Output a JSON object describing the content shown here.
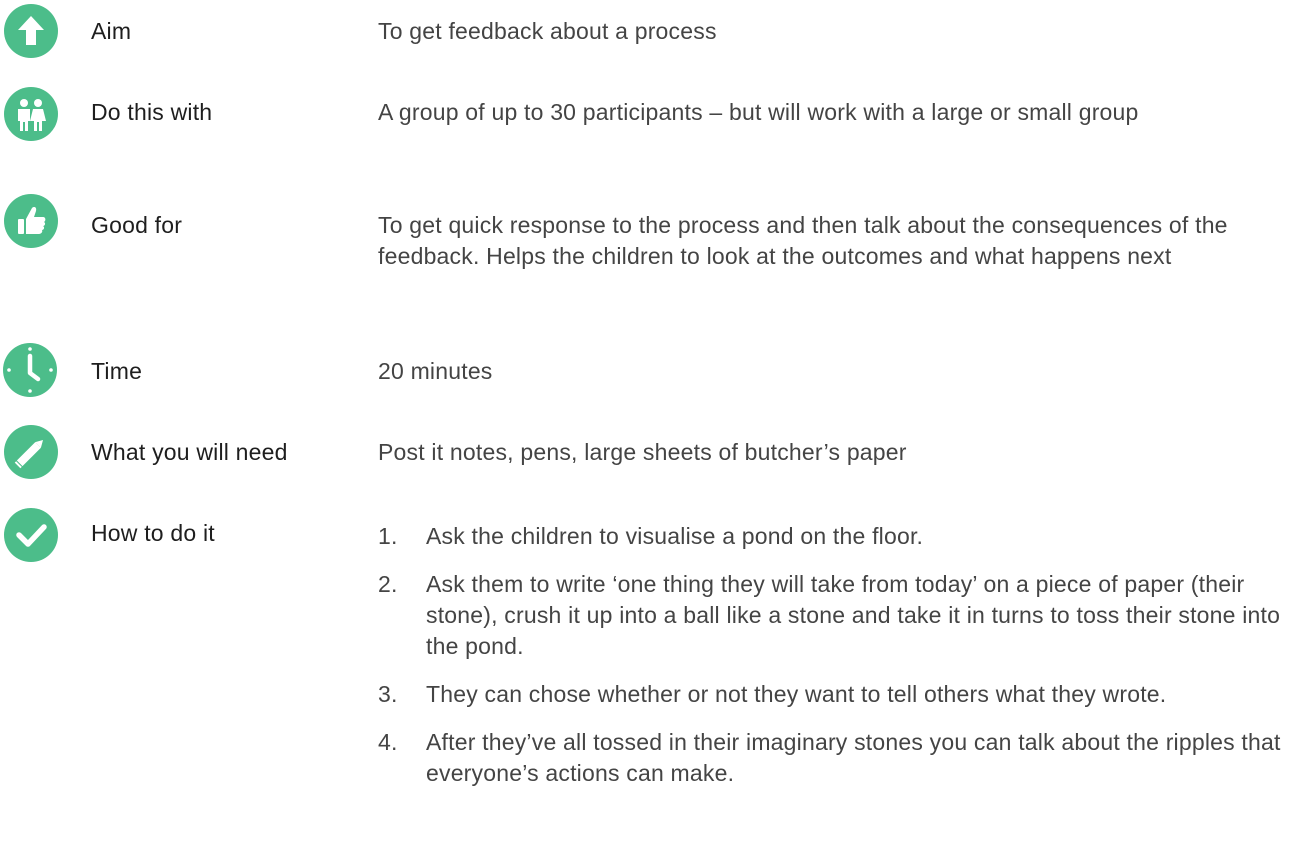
{
  "accent_color": "#4cbd8a",
  "rows": [
    {
      "icon": "up-arrow-icon",
      "label": "Aim",
      "value": "To get feedback about a process"
    },
    {
      "icon": "people-icon",
      "label": "Do this with",
      "value": "A group of up to 30 participants – but will work with a large or small group"
    },
    {
      "icon": "thumbs-up-icon",
      "label": "Good for",
      "value": "To get quick response to the process and then talk about the consequences of the feedback. Helps the children to look at the outcomes and what happens next"
    },
    {
      "icon": "clock-icon",
      "label": "Time",
      "value": "20 minutes"
    },
    {
      "icon": "pencil-icon",
      "label": "What you will need",
      "value": "Post it notes, pens, large sheets of butcher’s paper"
    },
    {
      "icon": "checkmark-icon",
      "label": "How to do it"
    }
  ],
  "steps": [
    {
      "num": "1.",
      "text": "Ask the children to visualise a pond on the floor."
    },
    {
      "num": "2.",
      "text": "Ask them to write ‘one thing they will take from today’ on a piece of paper (their stone), crush it up into a ball like a stone and take it in turns to toss their stone into the pond."
    },
    {
      "num": "3.",
      "text": "They can chose whether or not they want to tell others what they wrote."
    },
    {
      "num": "4.",
      "text": "After they’ve all tossed in their imaginary stones you can talk about the ripples that everyone’s actions can make."
    }
  ]
}
